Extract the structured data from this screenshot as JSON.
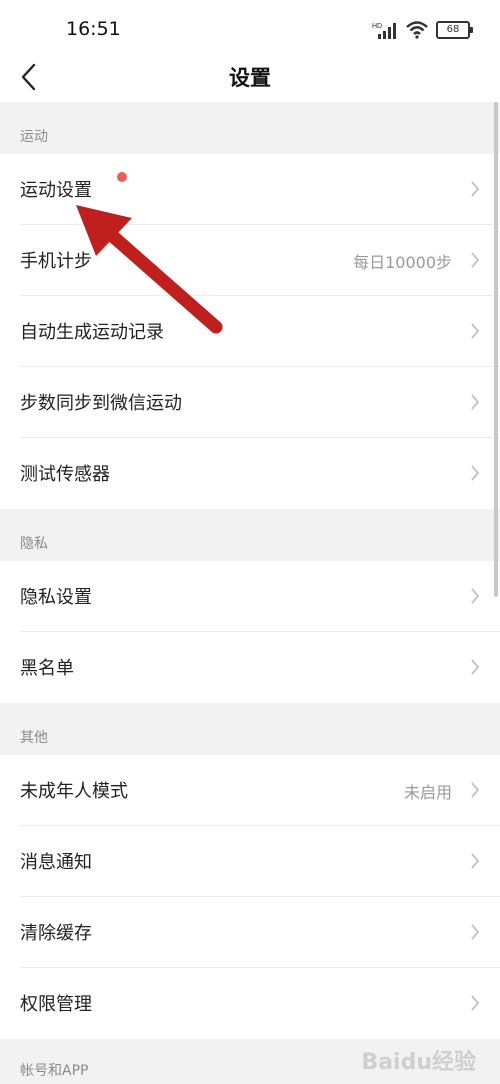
{
  "status": {
    "time": "16:51",
    "hd": "HD",
    "battery": "68"
  },
  "nav": {
    "title": "设置"
  },
  "sections": {
    "sport": "运动",
    "privacy": "隐私",
    "other": "其他",
    "account": "帐号和APP"
  },
  "rows": [
    {
      "label": "运动设置",
      "value": ""
    },
    {
      "label": "手机计步",
      "value": "每日10000步"
    },
    {
      "label": "自动生成运动记录",
      "value": ""
    },
    {
      "label": "步数同步到微信运动",
      "value": ""
    },
    {
      "label": "测试传感器",
      "value": ""
    },
    {
      "label": "隐私设置",
      "value": ""
    },
    {
      "label": "黑名单",
      "value": ""
    },
    {
      "label": "未成年人模式",
      "value": "未启用"
    },
    {
      "label": "消息通知",
      "value": ""
    },
    {
      "label": "清除缓存",
      "value": ""
    },
    {
      "label": "权限管理",
      "value": ""
    }
  ],
  "watermark": "Baidu经验",
  "colors": {
    "accent_dot": "#ea6058",
    "arrow": "#c0201d"
  },
  "icons": {
    "back": "chevron-left-icon",
    "row": "chevron-right-icon"
  }
}
